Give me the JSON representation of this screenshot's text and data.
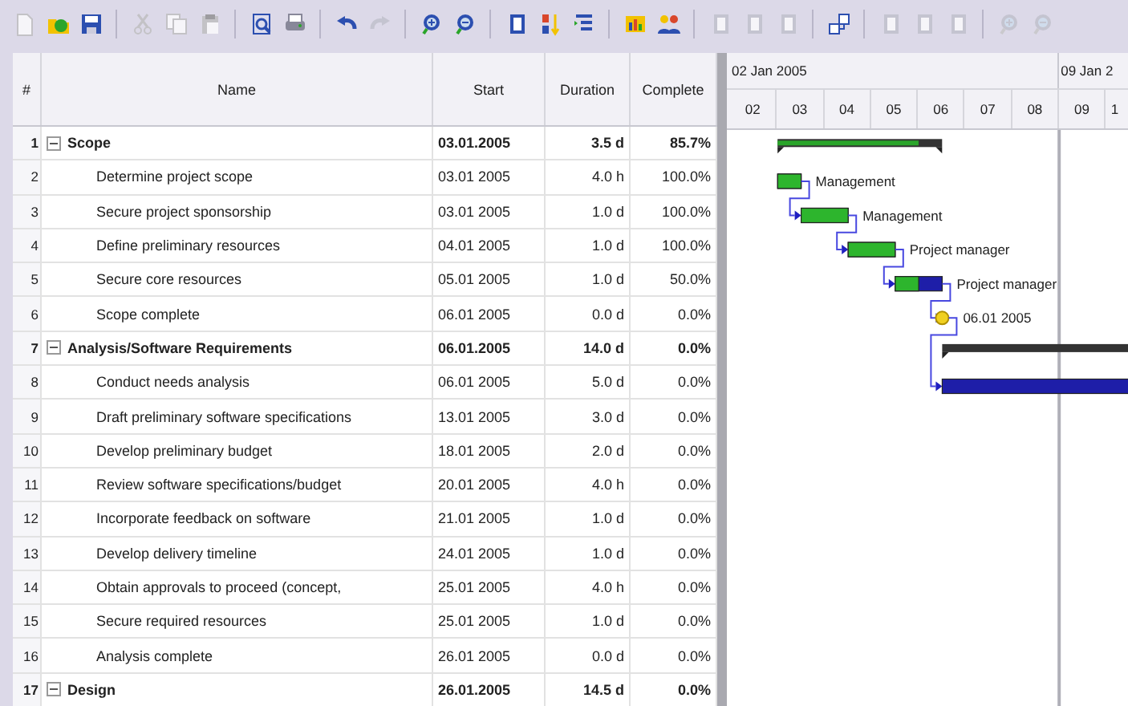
{
  "toolbar": [
    {
      "kind": "new",
      "disabled": true
    },
    {
      "kind": "open",
      "disabled": false
    },
    {
      "kind": "save",
      "disabled": false
    },
    {
      "kind": "separator"
    },
    {
      "kind": "cut",
      "disabled": true
    },
    {
      "kind": "copy",
      "disabled": true
    },
    {
      "kind": "paste",
      "disabled": true
    },
    {
      "kind": "separator"
    },
    {
      "kind": "preview",
      "disabled": false
    },
    {
      "kind": "print",
      "disabled": false
    },
    {
      "kind": "separator"
    },
    {
      "kind": "undo",
      "disabled": false
    },
    {
      "kind": "redo",
      "disabled": true
    },
    {
      "kind": "separator"
    },
    {
      "kind": "zoom-in",
      "disabled": false
    },
    {
      "kind": "zoom-out",
      "disabled": false
    },
    {
      "kind": "separator"
    },
    {
      "kind": "page",
      "disabled": false
    },
    {
      "kind": "sort",
      "disabled": false
    },
    {
      "kind": "indent",
      "disabled": false
    },
    {
      "kind": "separator"
    },
    {
      "kind": "chart",
      "disabled": false
    },
    {
      "kind": "people",
      "disabled": false
    },
    {
      "kind": "separator"
    },
    {
      "kind": "page",
      "disabled": true
    },
    {
      "kind": "page",
      "disabled": true
    },
    {
      "kind": "page",
      "disabled": true
    },
    {
      "kind": "separator"
    },
    {
      "kind": "link",
      "disabled": false
    },
    {
      "kind": "separator"
    },
    {
      "kind": "page",
      "disabled": true
    },
    {
      "kind": "page",
      "disabled": true
    },
    {
      "kind": "page",
      "disabled": true
    },
    {
      "kind": "separator"
    },
    {
      "kind": "zoom-in",
      "disabled": true
    },
    {
      "kind": "zoom-out",
      "disabled": true
    }
  ],
  "columns": [
    "#",
    "Name",
    "Start",
    "Duration",
    "Complete"
  ],
  "tasks": [
    {
      "id": "1",
      "kind": "summary",
      "expanded": true,
      "name": "Scope",
      "start": "03.01.2005",
      "duration": "3.5 d",
      "complete": "85.7%"
    },
    {
      "id": "2",
      "kind": "task",
      "name": "Determine project scope",
      "start": "03.01 2005",
      "duration": "4.0 h",
      "complete": "100.0%",
      "bar_label": "Management"
    },
    {
      "id": "3",
      "kind": "task",
      "name": "Secure project sponsorship",
      "start": "03.01 2005",
      "duration": "1.0 d",
      "complete": "100.0%",
      "bar_label": "Management"
    },
    {
      "id": "4",
      "kind": "task",
      "name": "Define preliminary resources",
      "start": "04.01 2005",
      "duration": "1.0 d",
      "complete": "100.0%",
      "bar_label": "Project manager"
    },
    {
      "id": "5",
      "kind": "task",
      "name": "Secure core resources",
      "start": "05.01 2005",
      "duration": "1.0 d",
      "complete": "50.0%",
      "bar_label": "Project manager"
    },
    {
      "id": "6",
      "kind": "milestone",
      "name": "Scope complete",
      "start": "06.01 2005",
      "duration": "0.0 d",
      "complete": "0.0%",
      "bar_label": "06.01 2005"
    },
    {
      "id": "7",
      "kind": "summary",
      "expanded": true,
      "name": "Analysis/Software Requirements",
      "start": "06.01.2005",
      "duration": "14.0 d",
      "complete": "0.0%"
    },
    {
      "id": "8",
      "kind": "task",
      "name": "Conduct needs analysis",
      "start": "06.01 2005",
      "duration": "5.0 d",
      "complete": "0.0%"
    },
    {
      "id": "9",
      "kind": "task",
      "name": "Draft preliminary software specifications",
      "start": "13.01 2005",
      "duration": "3.0 d",
      "complete": "0.0%"
    },
    {
      "id": "10",
      "kind": "task",
      "name": "Develop preliminary budget",
      "start": "18.01 2005",
      "duration": "2.0 d",
      "complete": "0.0%"
    },
    {
      "id": "11",
      "kind": "task",
      "name": "Review software specifications/budget",
      "start": "20.01 2005",
      "duration": "4.0 h",
      "complete": "0.0%"
    },
    {
      "id": "12",
      "kind": "task",
      "name": "Incorporate feedback on software",
      "start": "21.01 2005",
      "duration": "1.0 d",
      "complete": "0.0%"
    },
    {
      "id": "13",
      "kind": "task",
      "name": "Develop delivery timeline",
      "start": "24.01 2005",
      "duration": "1.0 d",
      "complete": "0.0%"
    },
    {
      "id": "14",
      "kind": "task",
      "name": "Obtain approvals to proceed (concept,",
      "start": "25.01 2005",
      "duration": "4.0 h",
      "complete": "0.0%"
    },
    {
      "id": "15",
      "kind": "task",
      "name": "Secure required resources",
      "start": "25.01 2005",
      "duration": "1.0 d",
      "complete": "0.0%"
    },
    {
      "id": "16",
      "kind": "milestone",
      "name": "Analysis complete",
      "start": "26.01 2005",
      "duration": "0.0 d",
      "complete": "0.0%"
    },
    {
      "id": "17",
      "kind": "summary",
      "expanded": true,
      "name": "Design",
      "start": "26.01.2005",
      "duration": "14.5 d",
      "complete": "0.0%"
    }
  ],
  "timeline": {
    "weeks": [
      "02 Jan 2005",
      "09 Jan 2"
    ],
    "days": [
      "02",
      "03",
      "04",
      "05",
      "06",
      "07",
      "08",
      "09",
      "1"
    ]
  }
}
